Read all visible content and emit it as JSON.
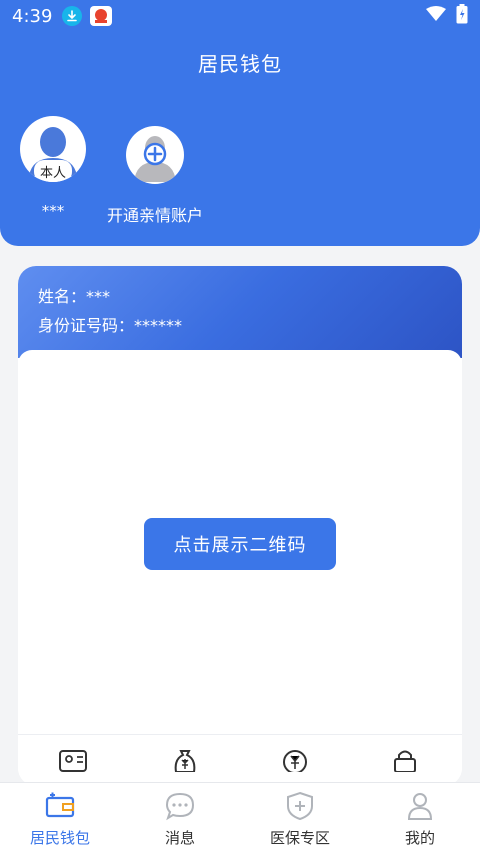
{
  "status_bar": {
    "time": "4:39"
  },
  "header": {
    "title": "居民钱包"
  },
  "accounts": [
    {
      "badge": "本人",
      "name": "***"
    },
    {
      "label": "开通亲情账户"
    }
  ],
  "card": {
    "name_line": "姓名：***",
    "id_line": "身份证号码：******",
    "qr_button_label": "点击展示二维码"
  },
  "tabs": [
    {
      "label": "居民钱包",
      "icon": "wallet-icon",
      "active": true
    },
    {
      "label": "消息",
      "icon": "message-icon",
      "active": false
    },
    {
      "label": "医保专区",
      "icon": "shield-plus-icon",
      "active": false
    },
    {
      "label": "我的",
      "icon": "person-icon",
      "active": false
    }
  ],
  "colors": {
    "primary": "#3b76e8",
    "download_badge": "#18b5ea"
  }
}
